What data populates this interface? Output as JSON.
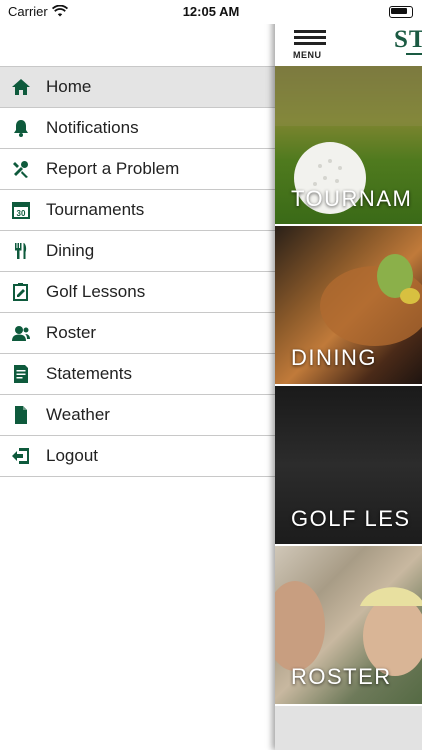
{
  "status_bar": {
    "carrier": "Carrier",
    "time": "12:05 AM"
  },
  "header": {
    "menu_label": "MENU",
    "logo_text": "ST"
  },
  "drawer": {
    "items": [
      {
        "label": "Home",
        "icon": "home-icon",
        "active": true
      },
      {
        "label": "Notifications",
        "icon": "bell-icon"
      },
      {
        "label": "Report a Problem",
        "icon": "tools-icon"
      },
      {
        "label": "Tournaments",
        "icon": "calendar-icon"
      },
      {
        "label": "Dining",
        "icon": "utensils-icon"
      },
      {
        "label": "Golf Lessons",
        "icon": "clipboard-icon"
      },
      {
        "label": "Roster",
        "icon": "users-icon"
      },
      {
        "label": "Statements",
        "icon": "statement-icon"
      },
      {
        "label": "Weather",
        "icon": "document-icon"
      },
      {
        "label": "Logout",
        "icon": "logout-icon"
      }
    ]
  },
  "tiles": [
    {
      "label": "TOURNAM"
    },
    {
      "label": "DINING"
    },
    {
      "label": "GOLF LES"
    },
    {
      "label": "ROSTER"
    }
  ],
  "colors": {
    "icon": "#0e5a3c",
    "accent": "#1a5a42",
    "active_row": "#e4e4e4"
  }
}
